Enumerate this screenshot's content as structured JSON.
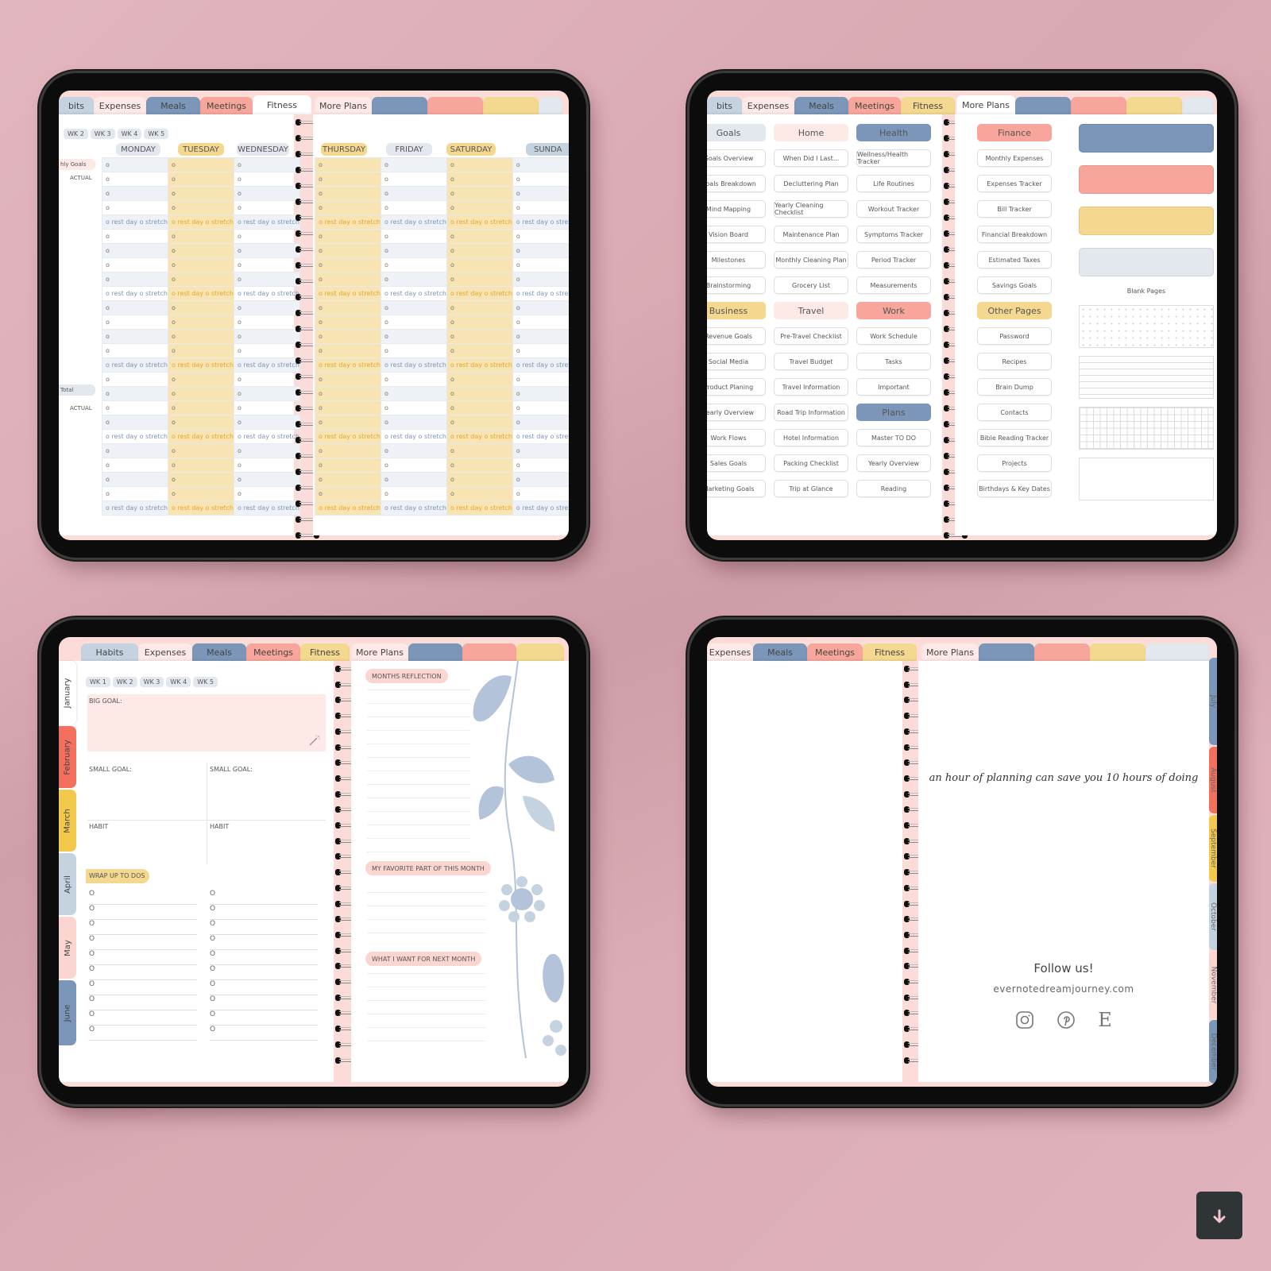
{
  "colors": {
    "blue": "#7b96b8",
    "light_blue": "#c5d3e1",
    "coral": "#f8a69b",
    "yellow": "#f4d890",
    "pink": "#fde9e6",
    "grey": "#e3e8ef",
    "background": "#e2b6bf"
  },
  "tablet1": {
    "tabs": [
      "bits",
      "Expenses",
      "Meals",
      "Meetings",
      "Fitness"
    ],
    "right_tabs": [
      "More Plans",
      "",
      "",
      "",
      ""
    ],
    "weeks": [
      "WK 2",
      "WK 3",
      "WK 4",
      "WK 5"
    ],
    "days_left": [
      "MONDAY",
      "TUESDAY",
      "WEDNESDAY"
    ],
    "days_right": [
      "THURSDAY",
      "FRIDAY",
      "SATURDAY",
      "SUNDA"
    ],
    "side_labels": {
      "goals": "hly Goals",
      "actual": "ACTUAL",
      "total": "Total",
      "actual2": "ACTUAL"
    },
    "cell_mark": "o",
    "rest_text": "o rest day o stretch"
  },
  "tablet2": {
    "tabs": [
      "bits",
      "Expenses",
      "Meals",
      "Meetings",
      "Fitness"
    ],
    "right_tabs": [
      "More Plans",
      "",
      "",
      "",
      ""
    ],
    "columns": [
      {
        "header": "Goals",
        "items": [
          "Goals Overview",
          "Goals Breakdown",
          "Mind Mapping",
          "Vision Board",
          "Milestones",
          "Brainstorming"
        ]
      },
      {
        "header": "Home",
        "items": [
          "When Did I Last...",
          "Decluttering Plan",
          "Yearly Cleaning Checklist",
          "Maintenance Plan",
          "Monthly Cleaning Plan",
          "Grocery List"
        ]
      },
      {
        "header": "Health",
        "items": [
          "Wellness/Health Tracker",
          "Life Routines",
          "Workout Tracker",
          "Symptoms Tracker",
          "Period Tracker",
          "Measurements"
        ]
      },
      {
        "header": "Business",
        "items": [
          "Revenue Goals",
          "Social Media",
          "Product Planing",
          "Yearly Overview",
          "Work Flows",
          "Sales Goals",
          "Marketing Goals"
        ]
      },
      {
        "header": "Travel",
        "items": [
          "Pre-Travel Checklist",
          "Travel Budget",
          "Travel Information",
          "Road Trip Information",
          "Hotel Information",
          "Packing Checklist",
          "Trip at Glance"
        ]
      },
      {
        "header": "Work",
        "items": [
          "Work Schedule",
          "Tasks",
          "Important"
        ]
      },
      {
        "header": "Plans",
        "items": [
          "Master TO DO",
          "Yearly  Overview",
          "Reading"
        ]
      },
      {
        "header": "Finance",
        "items": [
          "Monthly Expenses",
          "Expenses Tracker",
          "Bill Tracker",
          "Financial Breakdown",
          "Estimated Taxes",
          "Savings Goals"
        ]
      },
      {
        "header": "Other Pages",
        "items": [
          "Password",
          "Recipes",
          "Brain Dump",
          "Contacts",
          "Bible Reading Tracker",
          "Projects",
          "Birthdays & Key Dates"
        ]
      }
    ],
    "blank_pages_label": "Blank Pages"
  },
  "tablet3": {
    "tabs": [
      "Habits",
      "Expenses",
      "Meals",
      "Meetings",
      "Fitness"
    ],
    "right_tabs": [
      "More Plans",
      "",
      "",
      ""
    ],
    "months": [
      "January",
      "February",
      "March",
      "April",
      "May",
      "June"
    ],
    "weeks": [
      "WK 1",
      "WK 2",
      "WK 3",
      "WK 4",
      "WK 5"
    ],
    "big_goal": "BIG GOAL:",
    "small_goal": "SMALL GOAL:",
    "habit": "HABIT",
    "wrap_up": "WRAP UP TO DOS",
    "todo_mark": "O",
    "sections": [
      "MONTHS REFLECTION",
      "MY FAVORITE PART OF THIS MONTH",
      "WHAT I WANT FOR NEXT MONTH"
    ]
  },
  "tablet4": {
    "tabs": [
      "Expenses",
      "Meals",
      "Meetings",
      "Fitness"
    ],
    "right_tabs": [
      "More Plans",
      "",
      "",
      "",
      ""
    ],
    "quote": "an hour of planning can save you 10 hours of doing",
    "follow": "Follow us!",
    "website": "evernotedreamjourney.com",
    "social_icons": [
      "instagram-icon",
      "pinterest-icon",
      "etsy-icon"
    ],
    "etsy_letter": "E",
    "months": [
      "July",
      "August",
      "September",
      "October",
      "November",
      "December"
    ]
  }
}
